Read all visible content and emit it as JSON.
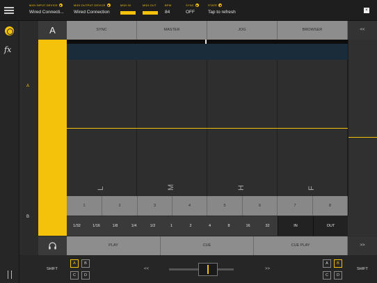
{
  "status": {
    "midi_input": {
      "label": "MIDI INPUT DEVICE",
      "value": "Wired Connecti..."
    },
    "midi_output": {
      "label": "MIDI OUTPUT DEVICE",
      "value": "Wired Connection"
    },
    "midi_in": {
      "label": "MIDI IN"
    },
    "midi_out": {
      "label": "MIDI OUT"
    },
    "bpm": {
      "label": "BPM",
      "value": "84"
    },
    "sync": {
      "label": "SYNC",
      "value": "OFF"
    },
    "state": {
      "label": "STATE",
      "value": "Tap to refresh"
    },
    "close_glyph": "×"
  },
  "rail": {
    "fx_label": "fx",
    "deck_a_mark": "A",
    "deck_b_mark": "B"
  },
  "header": {
    "deck": "A",
    "tabs": [
      "SYNC",
      "MASTER",
      "JOG",
      "BROWSER"
    ],
    "collapse": "<<"
  },
  "lanes": {
    "labels": [
      "L",
      "M",
      "H",
      "F"
    ]
  },
  "cues": [
    "1",
    "2",
    "3",
    "4",
    "5",
    "6",
    "7",
    "8"
  ],
  "loops": [
    "1/32",
    "1/16",
    "1/8",
    "1/4",
    "1/2",
    "1",
    "2",
    "4",
    "8",
    "16",
    "32",
    "IN",
    "OUT"
  ],
  "transport": {
    "buttons": [
      "PLAY",
      "CUE",
      "CUE PLAY"
    ],
    "collapse": ">>"
  },
  "bottom": {
    "shift_left": "SHIFT",
    "shift_right": "SHIFT",
    "decks_left": [
      "A",
      "B",
      "C",
      "D"
    ],
    "decks_right": [
      "A",
      "B",
      "C",
      "D"
    ],
    "prev": "<<",
    "next": ">>"
  },
  "colors": {
    "accent": "#f5c20b",
    "panel": "#2b2b2b",
    "button": "#8d8d8d"
  }
}
